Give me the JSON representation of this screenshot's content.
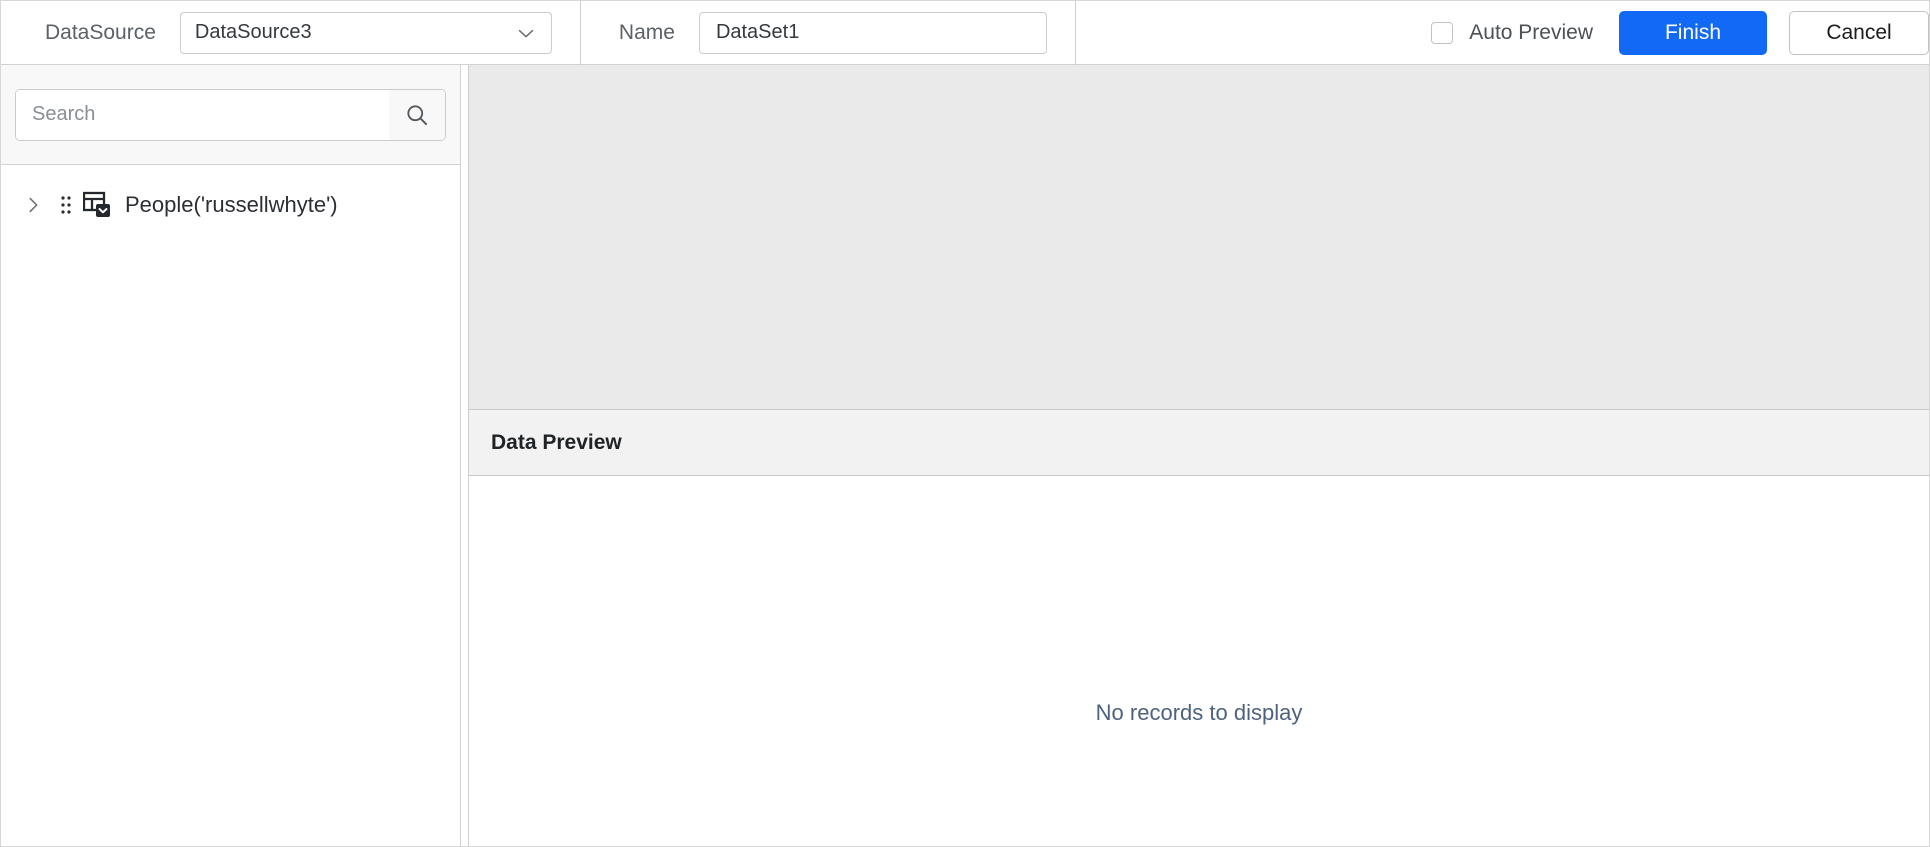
{
  "toolbar": {
    "datasource_label": "DataSource",
    "datasource_value": "DataSource3",
    "datasource_caret_icon": "chevron-down-icon",
    "name_label": "Name",
    "name_value": "DataSet1",
    "auto_preview_label": "Auto Preview",
    "auto_preview_checked": false,
    "finish_label": "Finish",
    "cancel_label": "Cancel",
    "finish_color": "#1169f5"
  },
  "sidebar": {
    "search": {
      "placeholder": "Search",
      "value": "",
      "icon": "search-icon"
    },
    "tree": [
      {
        "label": "People('russellwhyte')",
        "expander_icon": "chevron-right-icon",
        "drag_icon": "drag-handle-icon",
        "type_icon": "table-dropdown-icon",
        "expanded": false
      }
    ]
  },
  "main": {
    "canvas": {
      "background": "#eaeaea"
    },
    "preview": {
      "title": "Data Preview",
      "empty_message": "No records to display",
      "rows": [],
      "columns": []
    }
  }
}
